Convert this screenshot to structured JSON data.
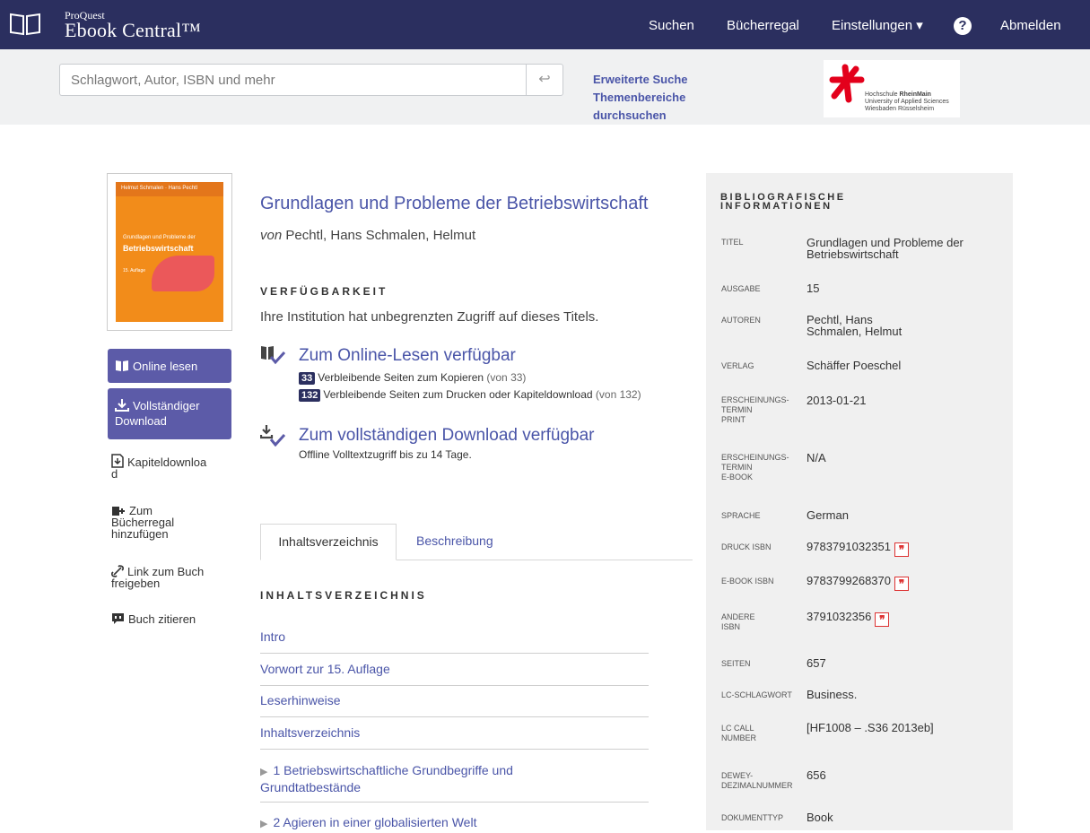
{
  "header": {
    "brand_small": "ProQuest",
    "brand_big": "Ebook Central™",
    "nav": {
      "search": "Suchen",
      "bookshelf": "Bücherregal",
      "settings": "Einstellungen ▾",
      "help": "?",
      "logout": "Abmelden"
    }
  },
  "search": {
    "placeholder": "Schlagwort, Autor, ISBN und mehr",
    "advanced": "Erweiterte Suche",
    "browse_line1": "Themenbereiche",
    "browse_line2": "durchsuchen"
  },
  "institution": {
    "line1_prefix": "Hochschule ",
    "line1_bold": "RheinMain",
    "line2": "University of Applied Sciences",
    "line3": "Wiesbaden Rüsselsheim"
  },
  "cover": {
    "authors": "Helmut Schmalen · Hans Pechtl",
    "subtitle": "Grundlagen und Probleme der",
    "title": "Betriebswirtschaft",
    "edition": "15. Auflage"
  },
  "actions": {
    "read_online": "Online lesen",
    "full_download_line1": "Vollständiger",
    "full_download_line2": "Download",
    "chapter_download_line1": "Kapiteldownloa",
    "chapter_download_line2": "d",
    "add_shelf_line1": "Zum",
    "add_shelf_line2": "Bücherregal",
    "add_shelf_line3": "hinzufügen",
    "share_line1": "Link zum Buch",
    "share_line2": "freigeben",
    "cite": "Buch zitieren"
  },
  "book": {
    "title": "Grundlagen und Probleme der Betriebswirtschaft",
    "by_prefix": "von",
    "authors": " Pechtl, Hans Schmalen, Helmut"
  },
  "availability": {
    "heading": "VERFÜGBARKEIT",
    "institution_text": "Ihre Institution hat unbegrenzten Zugriff auf dieses Titels.",
    "online_title": "Zum Online-Lesen verfügbar",
    "copy_count": "33",
    "copy_text": "Verbleibende Seiten zum Kopieren",
    "copy_total": "(von 33)",
    "print_count": "132",
    "print_text": "Verbleibende Seiten zum Drucken oder Kapiteldownload",
    "print_total": "(von 132)",
    "download_title": "Zum vollständigen Download verfügbar",
    "download_note": "Offline Volltextzugriff bis zu 14 Tage."
  },
  "tabs": {
    "toc": "Inhaltsverzeichnis",
    "description": "Beschreibung"
  },
  "toc": {
    "heading": "INHALTSVERZEICHNIS",
    "items": [
      "Intro",
      "Vorwort zur 15. Auflage",
      "Leserhinweise",
      "Inhaltsverzeichnis"
    ],
    "chapter1_line1": "1 Betriebswirtschaftliche Grundbegriffe und",
    "chapter1_line2": "Grundtatbestände",
    "chapter2": "2 Agieren in einer globalisierten Welt"
  },
  "bib": {
    "heading_line1": "BIBLIOGRAFISCHE",
    "heading_line2": "INFORMATIONEN",
    "title_label": "Titel",
    "title_line1": "Grundlagen und Probleme der",
    "title_line2": "Betriebswirtschaft",
    "edition_label": "Ausgabe",
    "edition": "15",
    "authors_label": "Autoren",
    "author1": "Pechtl, Hans",
    "author2": "Schmalen, Helmut",
    "publisher_label": "Verlag",
    "publisher": "Schäffer Poeschel",
    "print_date_label1": "Erscheinungs-",
    "print_date_label2": "termin",
    "print_date_label3": "Print",
    "print_date": "2013-01-21",
    "ebook_date_label1": "Erscheinungs-",
    "ebook_date_label2": "termin",
    "ebook_date_label3": "E-Book",
    "ebook_date": "N/A",
    "language_label": "Sprache",
    "language": "German",
    "print_isbn_label": "Druck ISBN",
    "print_isbn": "9783791032351",
    "ebook_isbn_label": "E-Book ISBN",
    "ebook_isbn": "9783799268370",
    "other_isbn_label1": "Andere",
    "other_isbn_label2": "ISBN",
    "other_isbn": "3791032356",
    "pages_label": "Seiten",
    "pages": "657",
    "lc_subject_label": "LC-Schlagwort",
    "lc_subject": "Business.",
    "lc_call_label1": "LC Call",
    "lc_call_label2": "Number",
    "lc_call": "[HF1008 – .S36 2013eb]",
    "dewey_label1": "Dewey-",
    "dewey_label2": "Dezimalnummer",
    "dewey": "656",
    "doctype_label": "Dokumenttyp",
    "doctype": "Book",
    "cite_glyph": "❞"
  },
  "colors": {
    "header_bg": "#2b2f5f",
    "accent": "#5c5ba8",
    "link": "#4a55a8",
    "panel_bg": "#f0f0f0"
  }
}
